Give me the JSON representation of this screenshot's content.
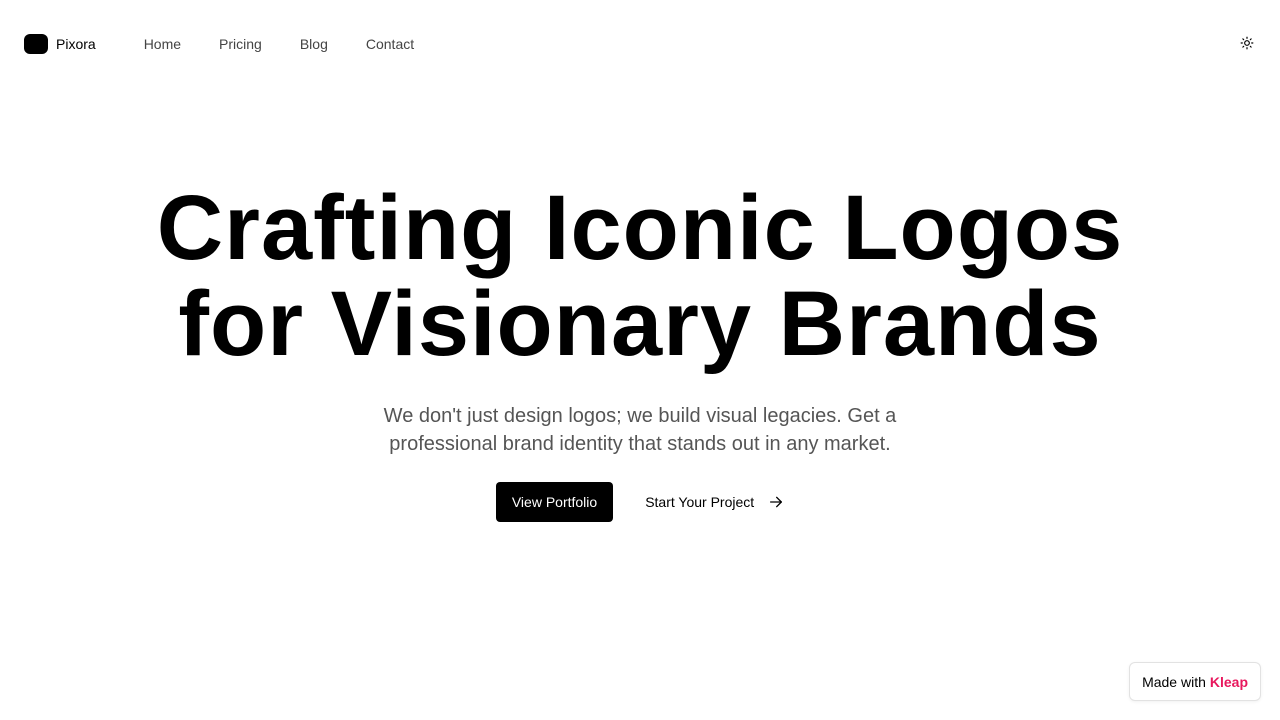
{
  "header": {
    "brand_name": "Pixora",
    "nav": [
      {
        "label": "Home"
      },
      {
        "label": "Pricing"
      },
      {
        "label": "Blog"
      },
      {
        "label": "Contact"
      }
    ],
    "theme_icon": "sun-icon"
  },
  "hero": {
    "title_line1": "Crafting Iconic Logos",
    "title_line2": "for Visionary Brands",
    "subtitle": "We don't just design logos; we build visual legacies. Get a professional brand identity that stands out in any market.",
    "primary_cta": "View Portfolio",
    "secondary_cta": "Start Your Project",
    "secondary_icon": "arrow-right-icon"
  },
  "badge": {
    "prefix": "Made with",
    "brand": "Kleap",
    "brand_color": "#e8175d"
  }
}
